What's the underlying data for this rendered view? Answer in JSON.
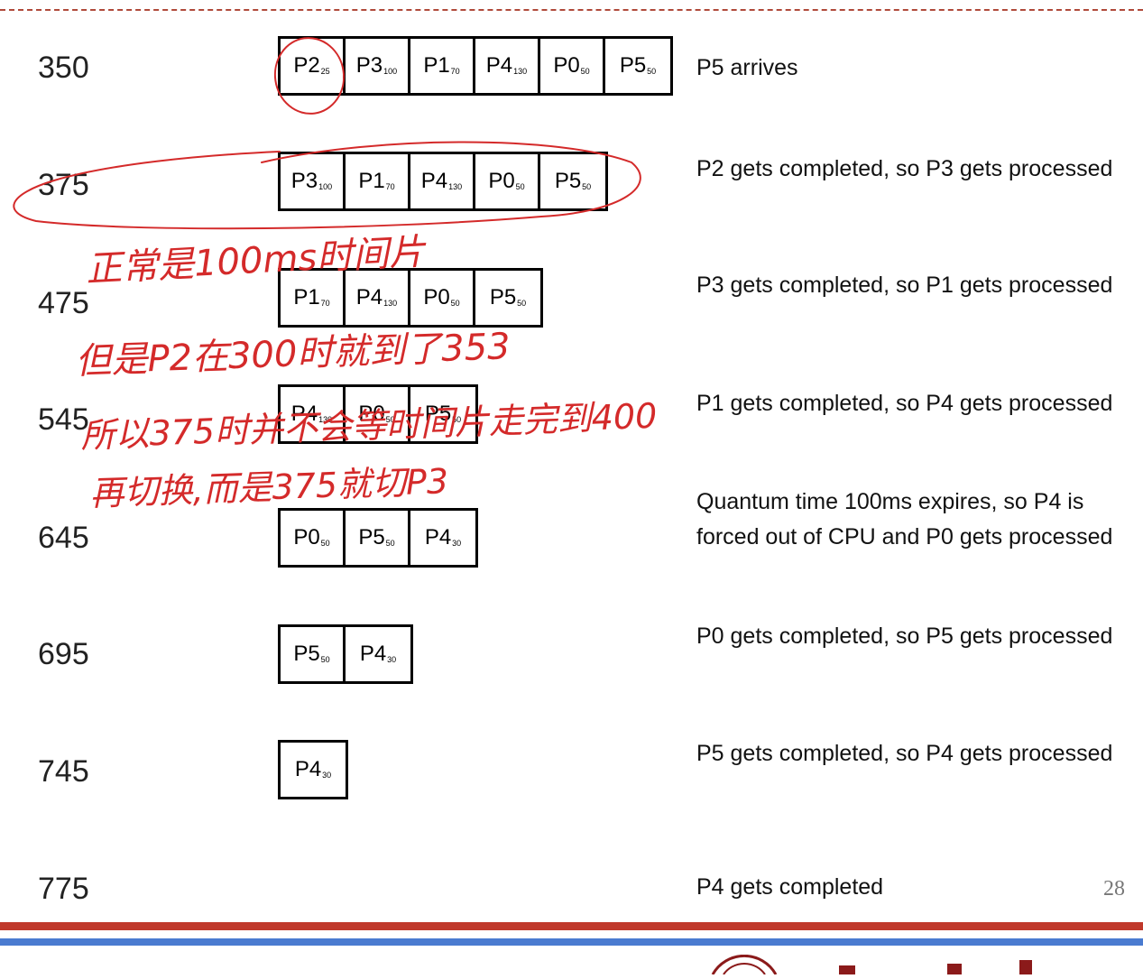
{
  "page_number": "28",
  "rows": [
    {
      "time": "350",
      "queue": [
        {
          "name": "P2",
          "sub": "25"
        },
        {
          "name": "P3",
          "sub": "100"
        },
        {
          "name": "P1",
          "sub": "70"
        },
        {
          "name": "P4",
          "sub": "130"
        },
        {
          "name": "P0",
          "sub": "50"
        },
        {
          "name": "P5",
          "sub": "50"
        }
      ],
      "desc": "P5 arrives"
    },
    {
      "time": "375",
      "queue": [
        {
          "name": "P3",
          "sub": "100"
        },
        {
          "name": "P1",
          "sub": "70"
        },
        {
          "name": "P4",
          "sub": "130"
        },
        {
          "name": "P0",
          "sub": "50"
        },
        {
          "name": "P5",
          "sub": "50"
        }
      ],
      "desc": "P2  gets completed, so P3 gets processed"
    },
    {
      "time": "475",
      "queue": [
        {
          "name": "P1",
          "sub": "70"
        },
        {
          "name": "P4",
          "sub": "130"
        },
        {
          "name": "P0",
          "sub": "50"
        },
        {
          "name": "P5",
          "sub": "50"
        }
      ],
      "desc": "P3 gets completed, so P1 gets processed"
    },
    {
      "time": "545",
      "queue": [
        {
          "name": "P4",
          "sub": "130"
        },
        {
          "name": "P0",
          "sub": "50"
        },
        {
          "name": "P5",
          "sub": "50"
        }
      ],
      "desc": "P1 gets completed, so P4 gets processed"
    },
    {
      "time": "645",
      "queue": [
        {
          "name": "P0",
          "sub": "50"
        },
        {
          "name": "P5",
          "sub": "50"
        },
        {
          "name": "P4",
          "sub": "30"
        }
      ],
      "desc": "Quantum time 100ms expires, so P4 is forced out of CPU and P0 gets processed"
    },
    {
      "time": "695",
      "queue": [
        {
          "name": "P5",
          "sub": "50"
        },
        {
          "name": "P4",
          "sub": "30"
        }
      ],
      "desc": "P0 gets completed, so P5 gets processed"
    },
    {
      "time": "745",
      "queue": [
        {
          "name": "P4",
          "sub": "30"
        }
      ],
      "desc": "P5 gets completed, so P4 gets processed"
    },
    {
      "time": "775",
      "queue": [],
      "desc": "P4 gets completed"
    }
  ],
  "handwritten_notes": [
    "正常是100ms时间片",
    "但是P2在300时就到了353",
    "所以375时并不会等时间片走完到400",
    "再切换,而是375就切P3"
  ],
  "colors": {
    "annotation_ink": "#d42a2a",
    "rule_red": "#c0392b",
    "rule_blue": "#4a7bd0"
  }
}
